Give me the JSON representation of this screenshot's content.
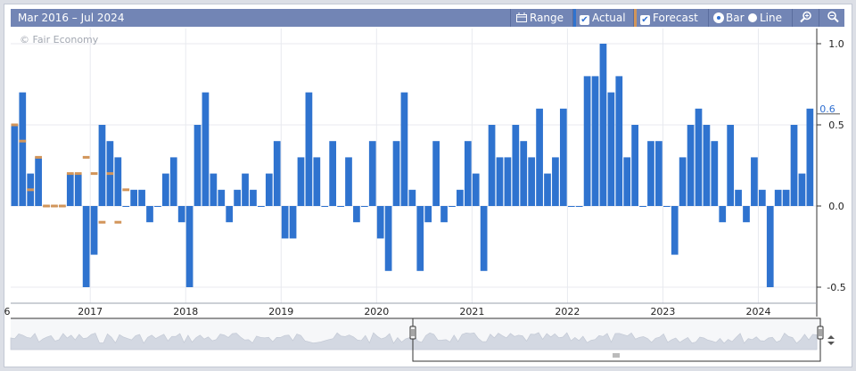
{
  "toolbar": {
    "date_range": "Mar 2016 – Jul 2024",
    "range_label": "Range",
    "actual_label": "Actual",
    "forecast_label": "Forecast",
    "bar_label": "Bar",
    "line_label": "Line",
    "zoom_in_icon": "zoom-in-icon",
    "zoom_out_icon": "zoom-out-icon",
    "calendar_icon": "calendar-icon"
  },
  "watermark": "© Fair Economy",
  "colors": {
    "actual": "#2f73cf",
    "forecast": "#d2955a",
    "toolbar": "#7285b5",
    "navigator_fill": "#d3d8e2"
  },
  "chart_data": {
    "type": "bar",
    "x_start": "2016-03",
    "x_end": "2024-07",
    "x_ticks": [
      "6",
      "2017",
      "2018",
      "2019",
      "2020",
      "2021",
      "2022",
      "2023",
      "2024"
    ],
    "y_ticks": [
      "1.0",
      "0.5",
      "0.0",
      "-0.5"
    ],
    "ylim": [
      -0.5,
      1.0
    ],
    "last_value_label": "0.6",
    "grid": true,
    "series": [
      {
        "name": "Actual",
        "values": [
          0.5,
          0.7,
          0.2,
          0.3,
          0.0,
          0.0,
          0.0,
          0.2,
          0.2,
          -0.5,
          -0.3,
          0.5,
          0.4,
          0.3,
          0.0,
          0.1,
          0.1,
          -0.1,
          0.0,
          0.2,
          0.3,
          -0.1,
          -0.5,
          0.5,
          0.7,
          0.2,
          0.1,
          -0.1,
          0.1,
          0.2,
          0.1,
          0.0,
          0.2,
          0.4,
          -0.2,
          -0.2,
          0.3,
          0.7,
          0.3,
          0.0,
          0.4,
          0.0,
          0.3,
          -0.1,
          0.0,
          0.4,
          -0.2,
          -0.4,
          0.4,
          0.7,
          0.1,
          -0.4,
          -0.1,
          0.4,
          -0.1,
          0.0,
          0.1,
          0.4,
          0.2,
          -0.4,
          0.5,
          0.3,
          0.3,
          0.5,
          0.4,
          0.3,
          0.6,
          0.2,
          0.3,
          0.6,
          0.0,
          0.0,
          0.8,
          0.8,
          1.0,
          0.7,
          0.8,
          0.3,
          0.5,
          0.0,
          0.4,
          0.4,
          0.0,
          -0.3,
          0.3,
          0.5,
          0.6,
          0.5,
          0.4,
          -0.1,
          0.5,
          0.1,
          -0.1,
          0.3,
          0.1,
          -0.5,
          0.1,
          0.1,
          0.5,
          0.2,
          0.6
        ]
      },
      {
        "name": "Forecast",
        "values": [
          0.5,
          0.4,
          0.1,
          0.3,
          0.0,
          0.0,
          0.0,
          0.2,
          0.2,
          0.3,
          0.2,
          -0.1,
          0.2,
          -0.1,
          0.1
        ]
      }
    ]
  }
}
